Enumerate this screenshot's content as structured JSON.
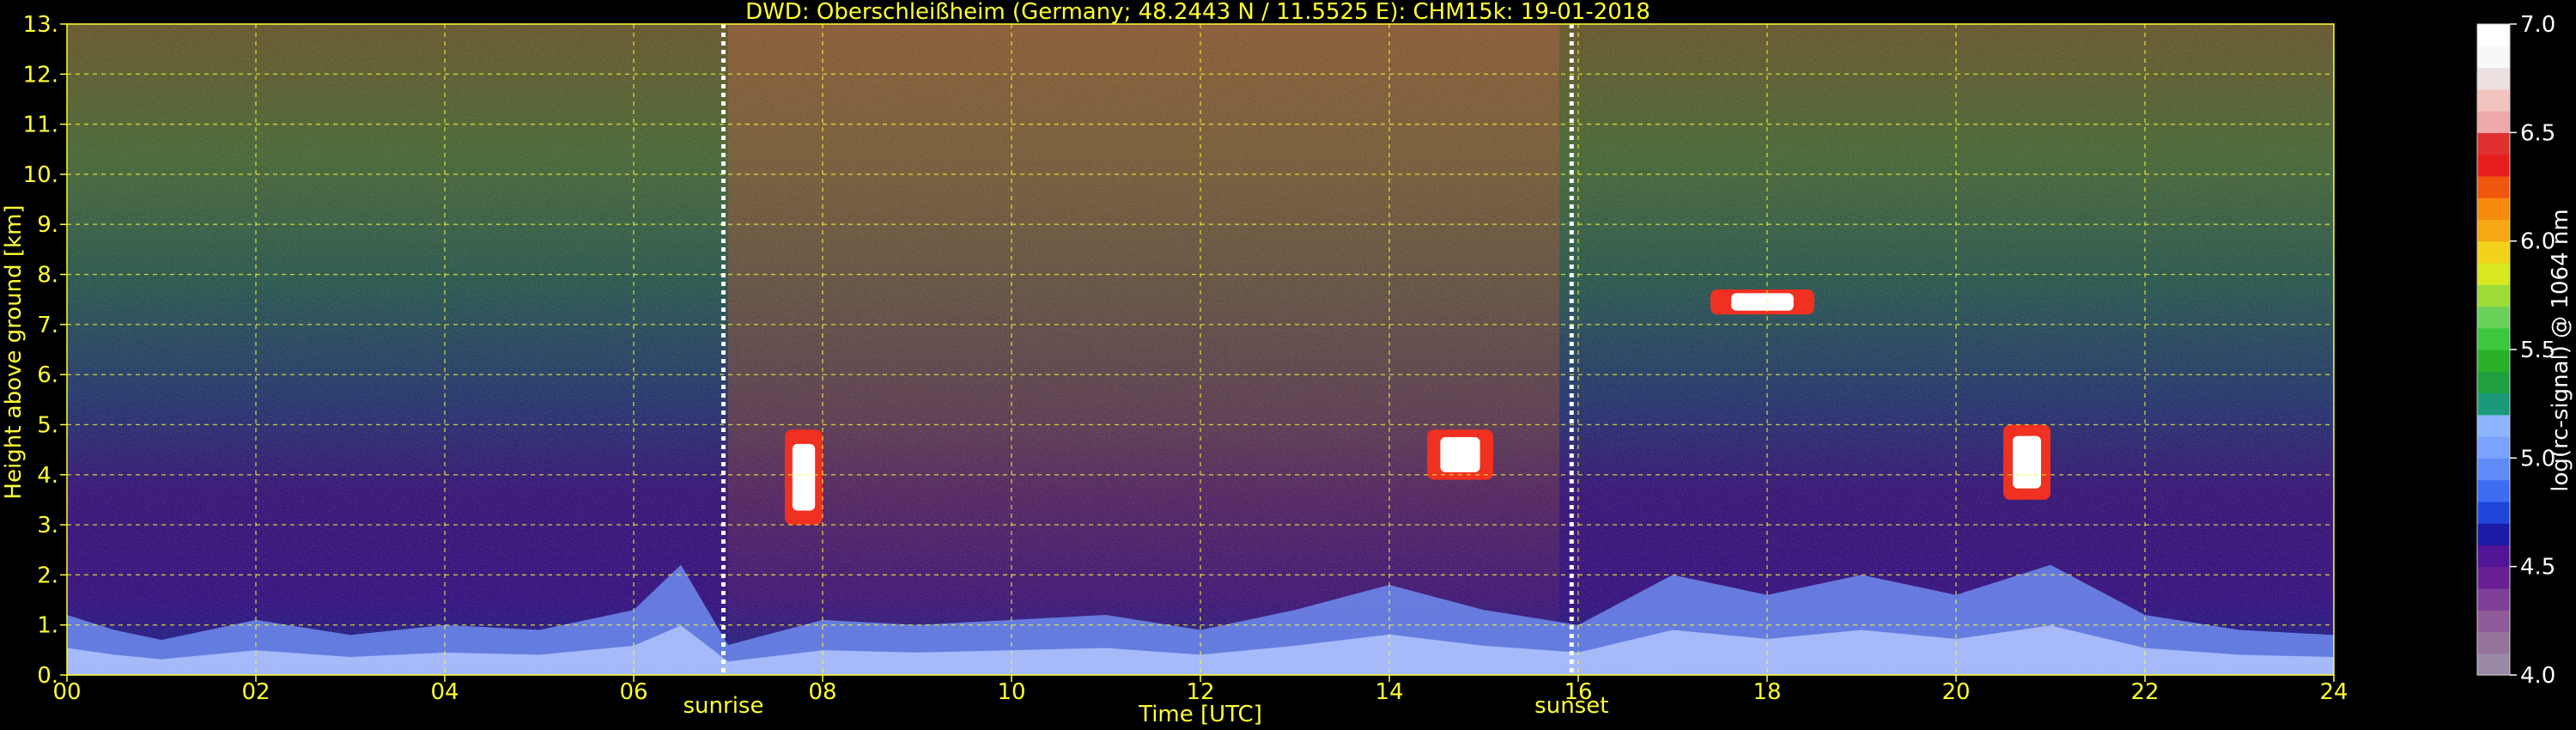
{
  "chart_data": {
    "type": "heatmap",
    "title": "DWD: Oberschleißheim (Germany; 48.2443 N / 11.5525 E):    CHM15k: 19-01-2018",
    "xlabel": "Time [UTC]",
    "ylabel": "Height above ground [km]",
    "xlim": [
      0,
      24
    ],
    "ylim": [
      0,
      13
    ],
    "x_ticks": [
      "00",
      "02",
      "04",
      "06",
      "08",
      "10",
      "12",
      "14",
      "16",
      "18",
      "20",
      "22",
      "24"
    ],
    "y_ticks": [
      "0.",
      "1.",
      "2.",
      "3.",
      "4.",
      "5.",
      "6.",
      "7.",
      "8.",
      "9.",
      "10.",
      "11.",
      "12.",
      "13."
    ],
    "grid": true,
    "events": [
      {
        "label": "sunrise",
        "time": 6.95
      },
      {
        "label": "sunset",
        "time": 15.93
      }
    ],
    "colorbar": {
      "label": "log(rc-signal) @ 1064 nm",
      "range": [
        4.0,
        7.0
      ],
      "ticks": [
        "4.0",
        "4.5",
        "5.0",
        "5.5",
        "6.0",
        "6.5",
        "7.0"
      ],
      "colors": [
        "#9a8aa6",
        "#96759b",
        "#8f5a98",
        "#7e3f98",
        "#6b1f96",
        "#521496",
        "#1a1aa6",
        "#1f46d8",
        "#3d6cf0",
        "#5f8cf8",
        "#7aa2ff",
        "#8fb4ff",
        "#1a9a7a",
        "#1fa040",
        "#28b028",
        "#3cc83c",
        "#6ad25a",
        "#9edc3a",
        "#d8e820",
        "#f2d21a",
        "#f5a814",
        "#f58a0e",
        "#f0560e",
        "#e61e1e",
        "#e03030",
        "#eeaaaa",
        "#f2c4c0",
        "#ece0e0",
        "#f8f8f8",
        "#ffffff"
      ]
    },
    "features": {
      "boundary_layer": "dense aerosol layer below 1.5 km, higher signal 06–08 UTC and 19–21 UTC",
      "clouds": [
        {
          "time_range": [
            7.6,
            8.0
          ],
          "height_range": [
            3.0,
            4.9
          ]
        },
        {
          "time_range": [
            14.4,
            15.1
          ],
          "height_range": [
            3.9,
            4.9
          ]
        },
        {
          "time_range": [
            17.4,
            18.5
          ],
          "height_range": [
            7.2,
            7.7
          ]
        },
        {
          "time_range": [
            20.5,
            21.0
          ],
          "height_range": [
            3.5,
            5.0
          ]
        }
      ]
    }
  }
}
